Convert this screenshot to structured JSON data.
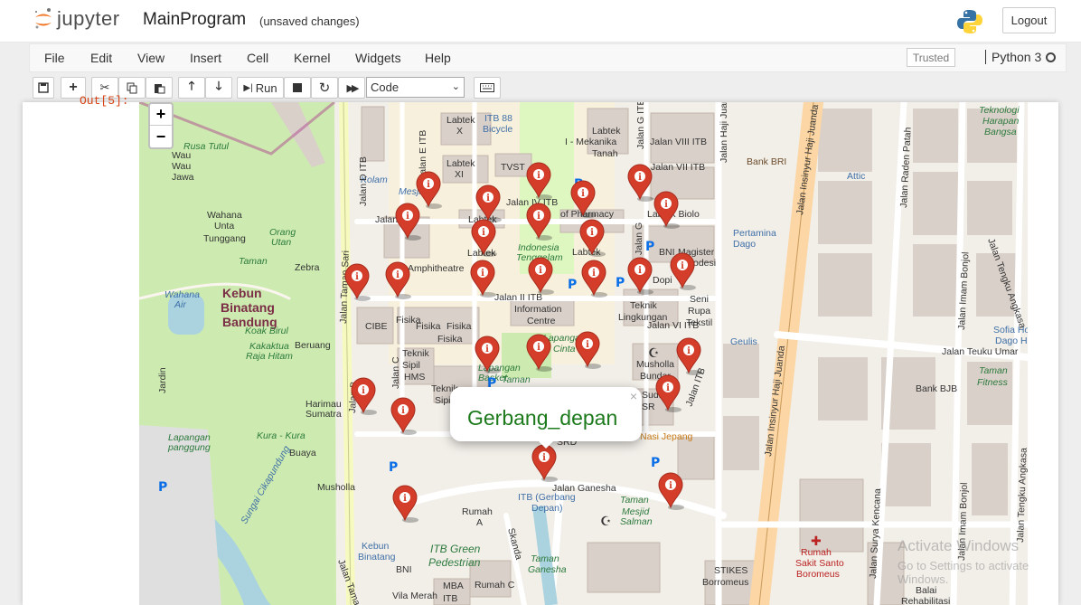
{
  "header": {
    "logo_text": "jupyter",
    "notebook_name": "MainProgram",
    "save_status": "(unsaved changes)",
    "logout_label": "Logout"
  },
  "menubar": {
    "items": [
      {
        "label": "File"
      },
      {
        "label": "Edit"
      },
      {
        "label": "View"
      },
      {
        "label": "Insert"
      },
      {
        "label": "Cell"
      },
      {
        "label": "Kernel"
      },
      {
        "label": "Widgets"
      },
      {
        "label": "Help"
      }
    ],
    "trusted_label": "Trusted",
    "kernel_name": "Python 3"
  },
  "toolbar": {
    "run_label": "Run",
    "cell_type": "Code"
  },
  "cell": {
    "output_prompt": "Out[5]:"
  },
  "map": {
    "popup_text": "Gerbang_depan",
    "marker_color": "#d33d29",
    "labels": [
      {
        "text": "Labtek X"
      },
      {
        "text": "ITB 88 Bicycle"
      },
      {
        "text": "Labtek I - Mekanika Tanah"
      },
      {
        "text": "Jalan VIII ITB"
      },
      {
        "text": "Jalan VII ITB"
      },
      {
        "text": "Labtek XI"
      },
      {
        "text": "TVST"
      },
      {
        "text": "Rusa Tutul"
      },
      {
        "text": "Wau Wau Jawa"
      },
      {
        "text": "Wahana Unta Tunggang"
      },
      {
        "text": "Orang Utan"
      },
      {
        "text": "Taman"
      },
      {
        "text": "Zebra"
      },
      {
        "text": "Kebun Binatang Bandung"
      },
      {
        "text": "Wahana Air"
      },
      {
        "text": "Koak Birul"
      },
      {
        "text": "Kakaktua Raja Hitam"
      },
      {
        "text": "Beruang"
      },
      {
        "text": "Amphitheatre"
      },
      {
        "text": "Indonesia Tenggelam"
      },
      {
        "text": "Pertamina Dago"
      },
      {
        "text": "BNI Magister Geodesi"
      },
      {
        "text": "Seni Rupa Tekstil"
      },
      {
        "text": "Teknik Lingkungan"
      },
      {
        "text": "Jalan VI ITB"
      },
      {
        "text": "CIBE"
      },
      {
        "text": "Fisika"
      },
      {
        "text": "Information Centre"
      },
      {
        "text": "Jalan II ITB"
      },
      {
        "text": "Geulis"
      },
      {
        "text": "Teknik Sipil"
      },
      {
        "text": "HMS"
      },
      {
        "text": "Musholla Bundar"
      },
      {
        "text": "Jalan Teuku Umar"
      },
      {
        "text": "Bank BJB"
      },
      {
        "text": "Taman Fitness"
      },
      {
        "text": "Harimau Sumatra"
      },
      {
        "text": "Lapangan panggung"
      },
      {
        "text": "Kura - Kura"
      },
      {
        "text": "Buaya"
      },
      {
        "text": "Musholla"
      },
      {
        "text": "Nasi Jepang"
      },
      {
        "text": "Jalan Ganesha"
      },
      {
        "text": "ITB (Gerbang Depan)"
      },
      {
        "text": "Taman Mesjid Salman"
      },
      {
        "text": "Rumah A"
      },
      {
        "text": "Skanda"
      },
      {
        "text": "ITB Green Pedestrian"
      },
      {
        "text": "Kebun Binatang"
      },
      {
        "text": "BNI"
      },
      {
        "text": "Vila Merah"
      },
      {
        "text": "MBA ITB"
      },
      {
        "text": "Rumah C"
      },
      {
        "text": "Taman Ganesha"
      },
      {
        "text": "STIKES Borromeus"
      },
      {
        "text": "Rumah Sakit Santo Borromeus"
      },
      {
        "text": "Balai Rehabilitasi"
      },
      {
        "text": "Jalan Insinyur Haji Juanda"
      },
      {
        "text": "Jalan Surya Kencana"
      },
      {
        "text": "Jalan Imam Bonjol"
      },
      {
        "text": "Jalan Tengku Angkasa"
      },
      {
        "text": "Jalan Raden Patah"
      },
      {
        "text": "Bank BRI"
      },
      {
        "text": "Attic"
      },
      {
        "text": "Teknologi Harapan Bangsa"
      },
      {
        "text": "Sofia Ho Dago He"
      },
      {
        "text": "Jalan Taman Sari"
      },
      {
        "text": "Sungai Cikapundung"
      },
      {
        "text": "Jalan D ITB"
      },
      {
        "text": "Jalan E ITB"
      },
      {
        "text": "Jalan G ITB"
      },
      {
        "text": "Jalan IV ITB"
      },
      {
        "text": "Labtek VIII"
      },
      {
        "text": "School of Pharmacy"
      },
      {
        "text": "Labtek Biologi"
      },
      {
        "text": "Lapangan Basket"
      },
      {
        "text": "Lapangan Cinta"
      },
      {
        "text": "Jalan Tama"
      },
      {
        "text": "Jalan Haji Juanda"
      },
      {
        "text": "Jalan C"
      },
      {
        "text": "Jalan B"
      },
      {
        "text": "Jalan I ITB"
      },
      {
        "text": "Teknik Sipil"
      },
      {
        "text": "Kolam Mesjid"
      },
      {
        "text": "Jardin"
      }
    ]
  },
  "watermark": {
    "line1": "Activate Windows",
    "line2": "Go to Settings to activate Windows."
  }
}
